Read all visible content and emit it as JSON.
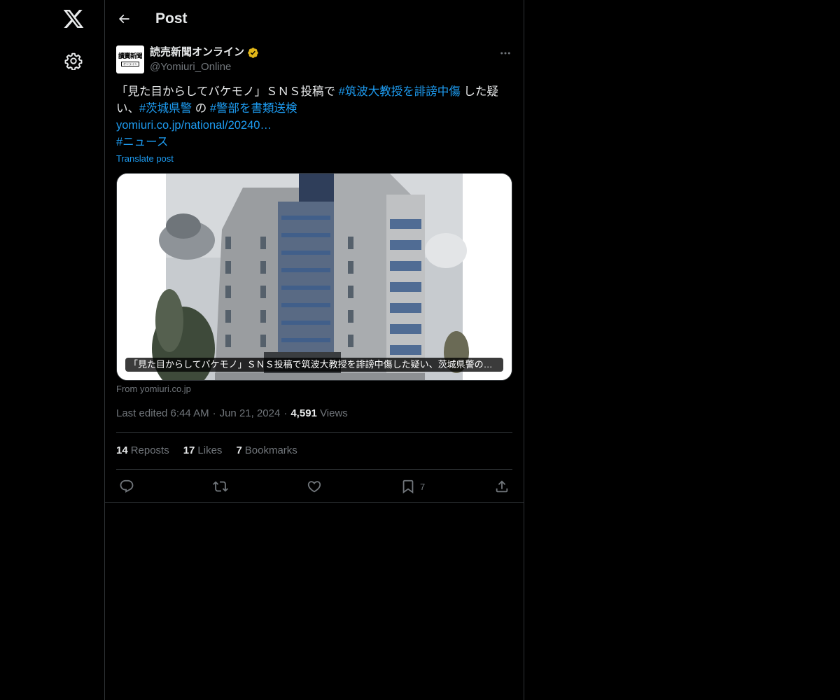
{
  "nav": {
    "logo_icon": "x-logo-icon",
    "settings_icon": "gear-icon"
  },
  "header": {
    "title": "Post",
    "back_icon": "arrow-left-icon"
  },
  "post": {
    "author": {
      "name": "読売新聞オンライン",
      "handle": "@Yomiuri_Online",
      "verified": true,
      "avatar_text": "讀賣新聞",
      "avatar_subtext": "オンライン"
    },
    "text": {
      "part1": "「見た目からしてバケモノ」ＳＮＳ投稿で ",
      "hashtag1": "#筑波大教授を誹謗中傷",
      "part2": " した疑い、",
      "hashtag2": "#茨城県警",
      "part3": " の ",
      "hashtag3": "#警部を書類送検",
      "link": "yomiuri.co.jp/national/20240…",
      "hashtag4": "#ニュース"
    },
    "translate_label": "Translate post",
    "card": {
      "caption": "「見た目からしてバケモノ」ＳＮＳ投稿で筑波大教授を誹謗中傷した疑い、茨城県警の警...",
      "source": "From yomiuri.co.jp"
    },
    "meta": {
      "edited": "Last edited 6:44 AM",
      "date": "Jun 21, 2024",
      "views_count": "4,591",
      "views_label": "Views"
    },
    "stats": {
      "reposts_count": "14",
      "reposts_label": "Reposts",
      "likes_count": "17",
      "likes_label": "Likes",
      "bookmarks_count": "7",
      "bookmarks_label": "Bookmarks"
    },
    "actions": {
      "bookmark_count": "7"
    }
  },
  "colors": {
    "background": "#000000",
    "text": "#e7e9ea",
    "muted": "#71767b",
    "accent": "#1d9bf0",
    "border": "#2f3336",
    "verified_gold": "#e2b719"
  }
}
